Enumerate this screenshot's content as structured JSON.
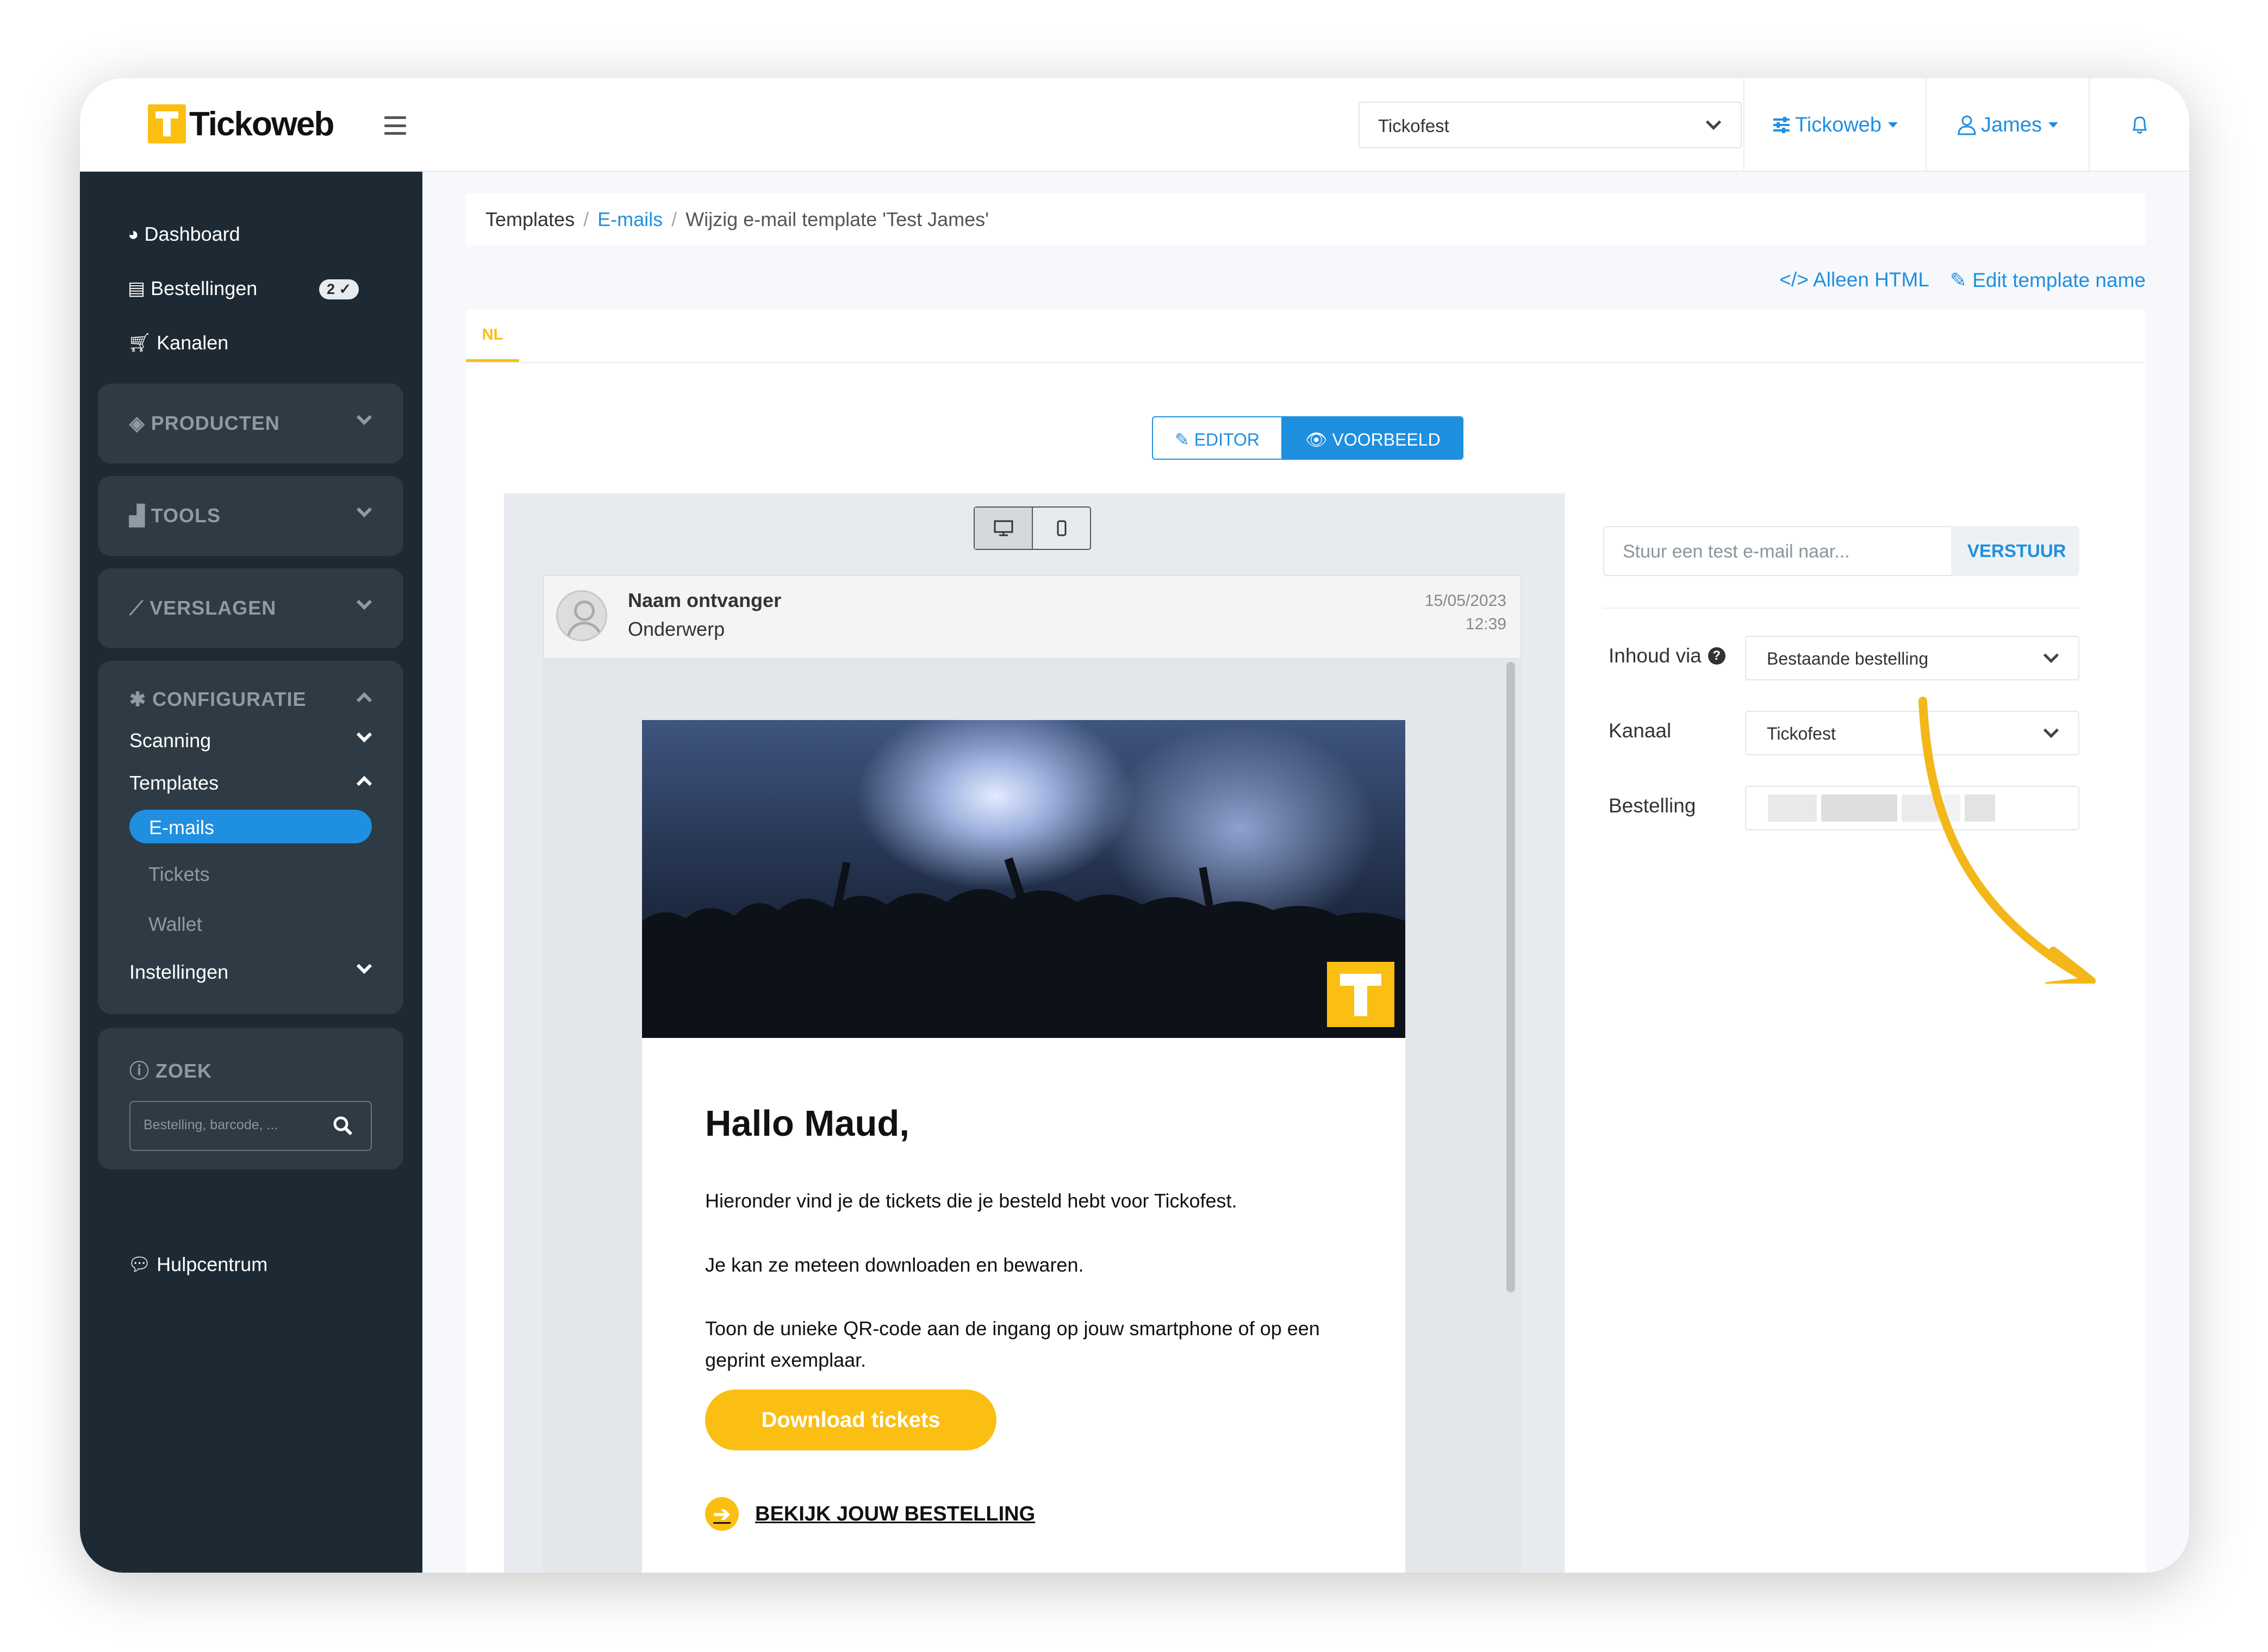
{
  "brand": {
    "name": "Tickoweb",
    "color": "#fbbf13"
  },
  "topbar": {
    "event_select": "Tickofest",
    "org_menu": "Tickoweb",
    "user_menu": "James"
  },
  "sidebar": {
    "top_items": [
      {
        "label": "Dashboard",
        "icon": "dashboard-icon"
      },
      {
        "label": "Bestellingen",
        "icon": "file-icon",
        "badge": "2"
      },
      {
        "label": "Kanalen",
        "icon": "cart-icon"
      }
    ],
    "groups": {
      "producten": "PRODUCTEN",
      "tools": "TOOLS",
      "verslagen": "VERSLAGEN",
      "configuratie": "CONFIGURATIE",
      "zoek": "ZOEK"
    },
    "config_items": {
      "scanning": "Scanning",
      "templates": "Templates",
      "emails": "E-mails",
      "tickets": "Tickets",
      "wallet": "Wallet",
      "instellingen": "Instellingen"
    },
    "search_placeholder": "Bestelling, barcode, ...",
    "help": "Hulpcentrum"
  },
  "breadcrumb": {
    "root": "Templates",
    "section": "E-mails",
    "current": "Wijzig e-mail template 'Test James'"
  },
  "actions": {
    "html_only": "Alleen HTML",
    "edit_name": "Edit template name"
  },
  "language_tab": "NL",
  "mode_toggle": {
    "editor": "EDITOR",
    "preview": "VOORBEELD",
    "active": "VOORBEELD"
  },
  "mail_preview": {
    "recipient": "Naam ontvanger",
    "subject": "Onderwerp",
    "date": "15/05/2023",
    "time": "12:39",
    "greeting": "Hallo Maud,",
    "paragraph1": "Hieronder vind je de tickets die je besteld hebt voor Tickofest.",
    "paragraph2": "Je kan ze meteen downloaden en bewaren.",
    "paragraph3": "Toon de unieke QR-code aan de ingang op jouw smartphone of op een geprint exemplaar.",
    "download_button": "Download tickets",
    "order_link": "BEKIJK JOUW BESTELLING"
  },
  "right_panel": {
    "test_email_placeholder": "Stuur een test e-mail naar...",
    "send_button": "VERSTUUR",
    "content_via_label": "Inhoud via",
    "content_via_value": "Bestaande bestelling",
    "channel_label": "Kanaal",
    "channel_value": "Tickofest",
    "order_label": "Bestelling"
  },
  "colors": {
    "accent": "#1f8fe0",
    "sidebar": "#1e2a33",
    "brand_yellow": "#fbbf13"
  }
}
